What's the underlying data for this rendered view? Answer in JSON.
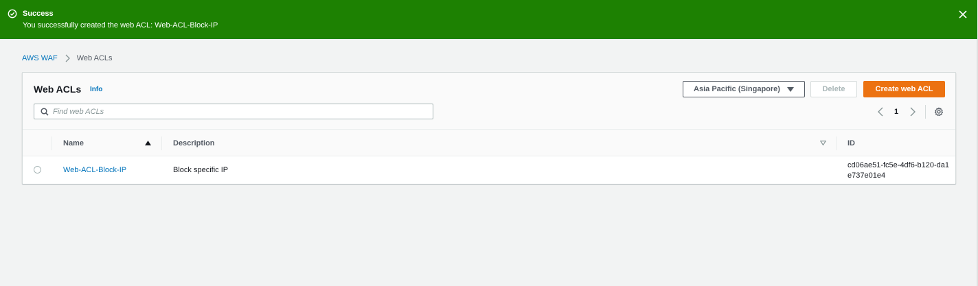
{
  "flash": {
    "title": "Success",
    "message": "You successfully created the web ACL: Web-ACL-Block-IP",
    "color": "#1d8102"
  },
  "breadcrumb": {
    "root": "AWS WAF",
    "current": "Web ACLs"
  },
  "panel": {
    "title": "Web ACLs",
    "info_label": "Info",
    "region_label": "Asia Pacific (Singapore)",
    "delete_label": "Delete",
    "create_label": "Create web ACL",
    "accent_color": "#ec7211"
  },
  "search": {
    "placeholder": "Find web ACLs",
    "value": ""
  },
  "pagination": {
    "current_page": "1"
  },
  "table": {
    "columns": [
      "Name",
      "Description",
      "ID"
    ],
    "rows": [
      {
        "name": "Web-ACL-Block-IP",
        "description": "Block specific IP",
        "id": "cd06ae51-fc5e-4df6-b120-da1e737e01e4",
        "selected": false
      }
    ]
  },
  "icons": {
    "flash": "success-check-icon",
    "close": "close-icon",
    "breadcrumb_separator": "chevron-right-icon",
    "dropdown": "caret-down-icon",
    "search": "search-icon",
    "prev": "chevron-left-icon",
    "next": "chevron-right-icon",
    "settings": "gear-icon",
    "sort_name": "sort-ascending-icon",
    "sort_desc": "sort-descending-icon"
  }
}
